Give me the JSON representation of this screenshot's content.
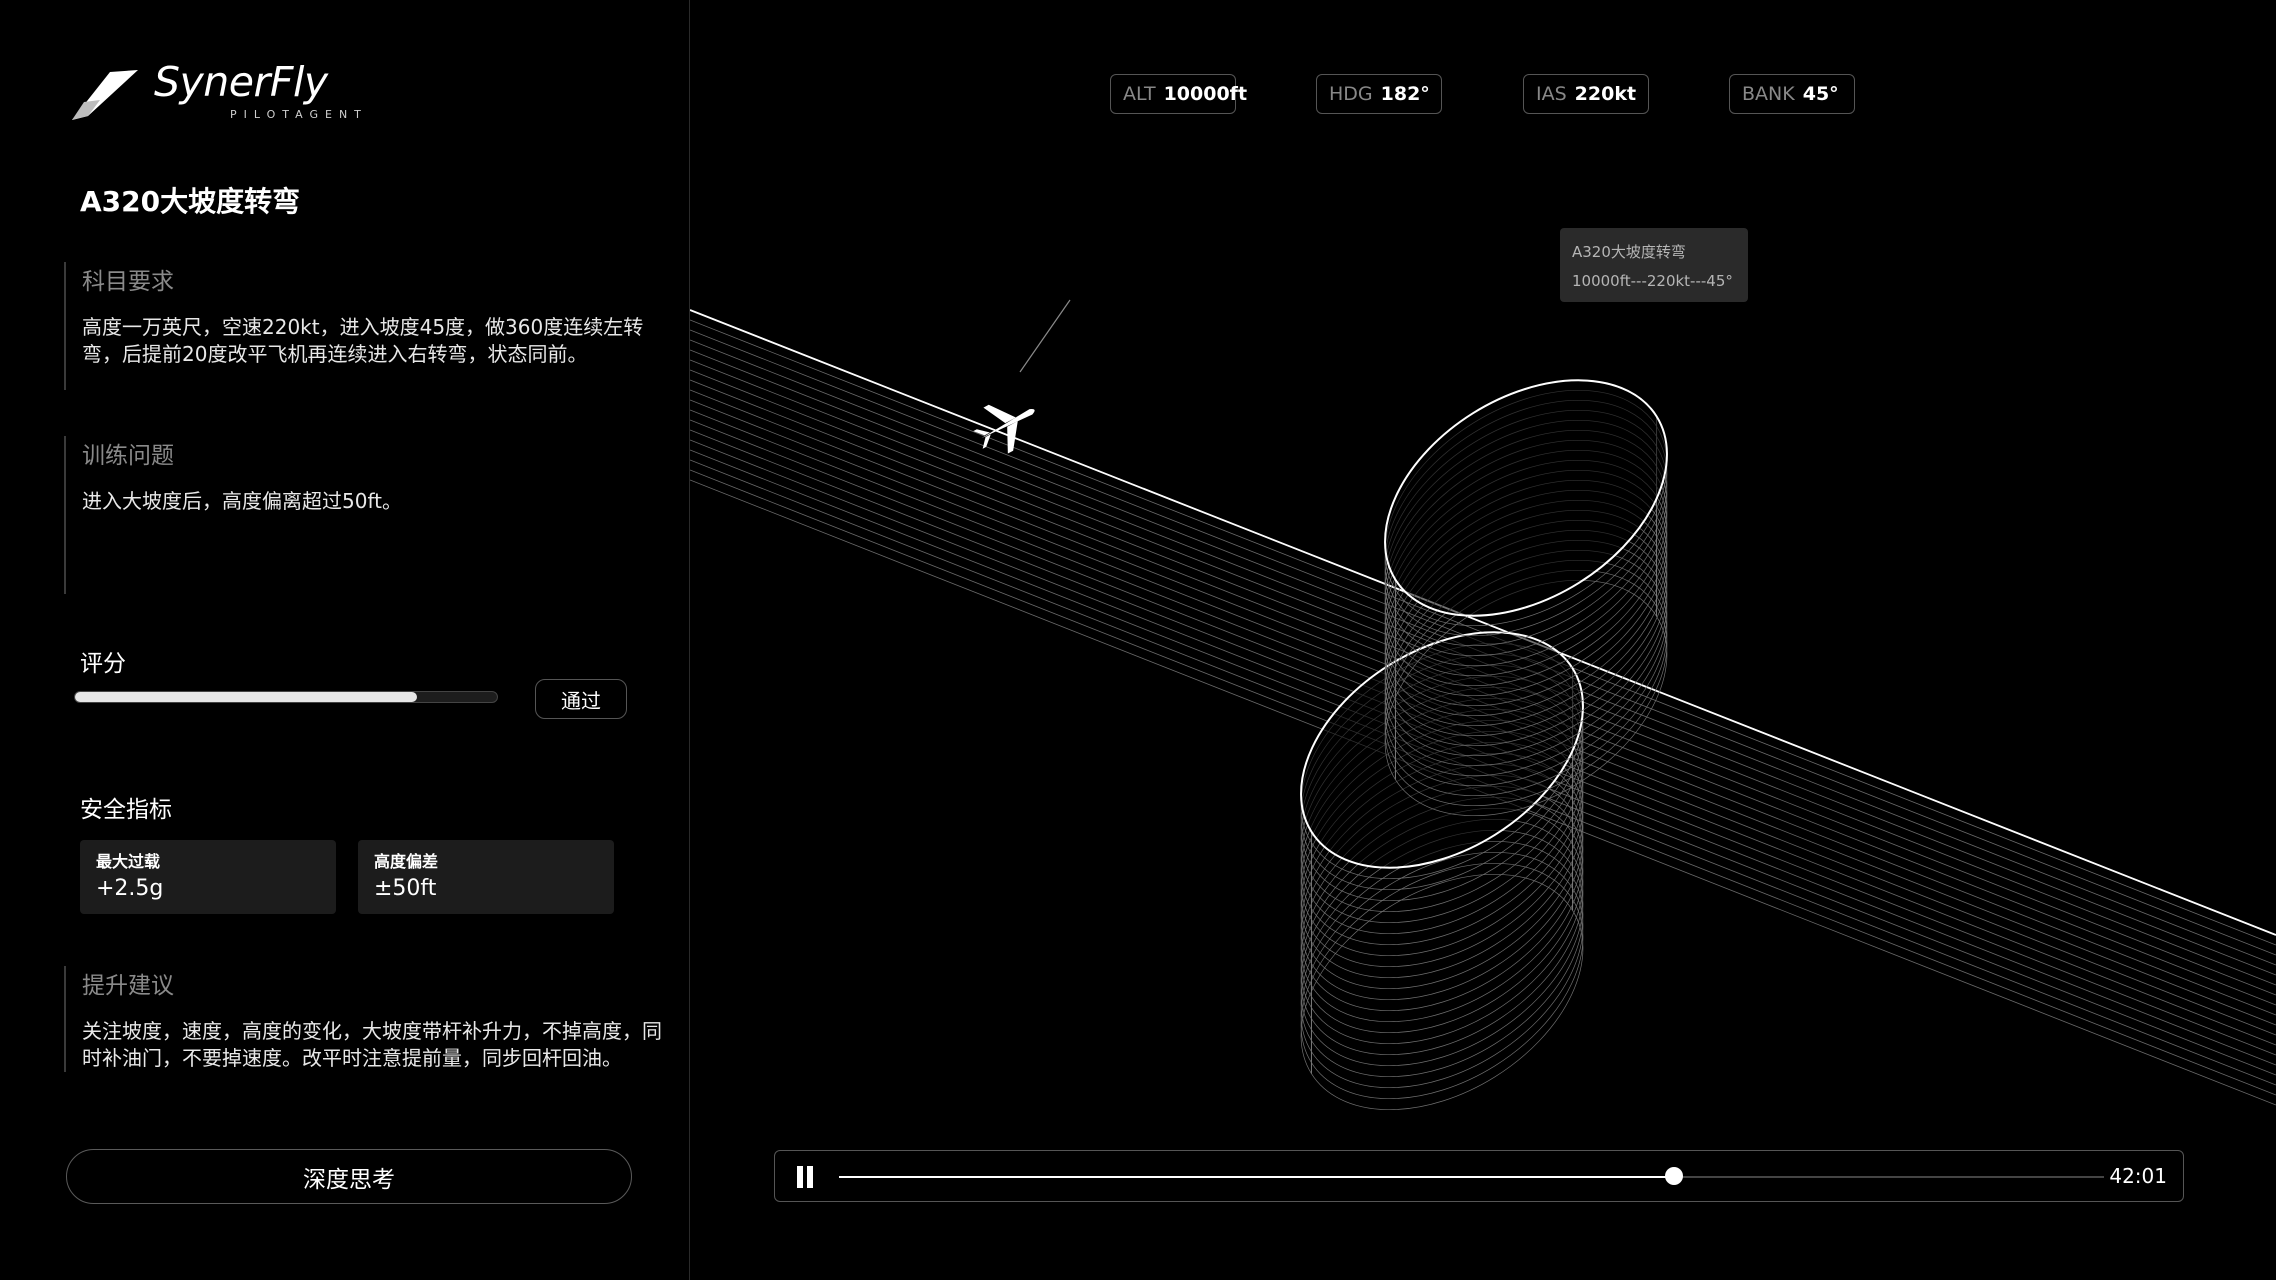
{
  "brand": {
    "name": "SynerFly",
    "tagline": "PILOTAGENT"
  },
  "task": {
    "title": "A320大坡度转弯",
    "requirement_label": "科目要求",
    "requirement_text": "高度一万英尺，空速220kt，进入坡度45度，做360度连续左转弯，后提前20度改平飞机再连续进入右转弯，状态同前。",
    "issue_label": "训练问题",
    "issue_text": "进入大坡度后，高度偏离超过50ft。"
  },
  "score": {
    "label": "评分",
    "progress": 0.81,
    "pass_label": "通过"
  },
  "safety": {
    "label": "安全指标",
    "metrics": [
      {
        "label": "最大过载",
        "value": "+2.5g"
      },
      {
        "label": "高度偏差",
        "value": "±50ft"
      }
    ]
  },
  "advice": {
    "label": "提升建议",
    "text": "关注坡度，速度，高度的变化，大坡度带杆补升力，不掉高度，同时补油门，不要掉速度。改平时注意提前量，同步回杆回油。"
  },
  "deep_think_label": "深度思考",
  "instruments": [
    {
      "key": "ALT",
      "value": "10000ft"
    },
    {
      "key": "HDG",
      "value": "182°"
    },
    {
      "key": "IAS",
      "value": "220kt"
    },
    {
      "key": "BANK",
      "value": "45°"
    }
  ],
  "callout": {
    "title": "A320大坡度转弯",
    "detail": "10000ft---220kt---45°"
  },
  "playback": {
    "state": "playing",
    "time": "42:01",
    "progress": 0.66
  },
  "icons": {
    "logo": "synerfly-wing-logo",
    "pause": "pause-icon",
    "aircraft": "airplane-icon"
  }
}
